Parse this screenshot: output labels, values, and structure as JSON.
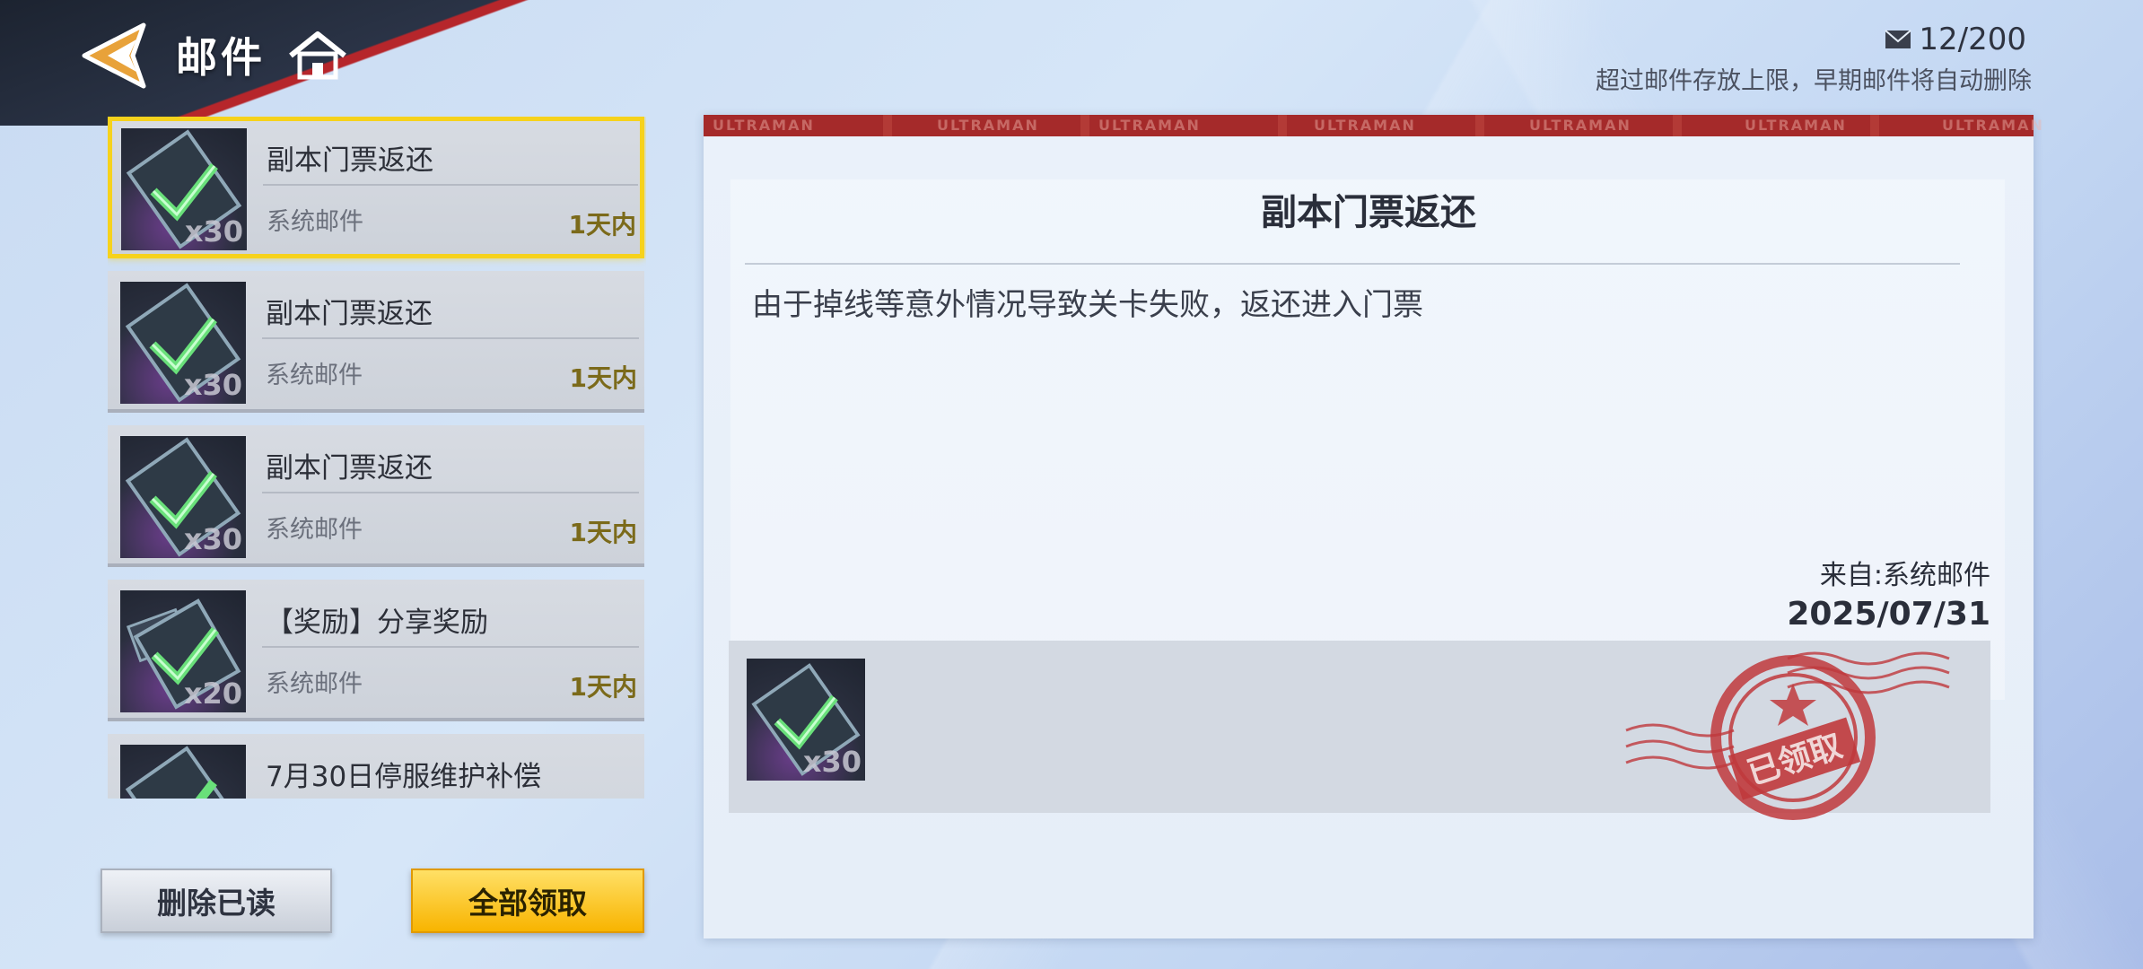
{
  "header": {
    "title": "邮件",
    "mail_count": "12/200",
    "mail_note": "超过邮件存放上限，早期邮件将自动删除"
  },
  "mail_list": [
    {
      "title": "副本门票返还",
      "sender": "系统邮件",
      "expire": "1天内",
      "qty": "x30",
      "selected": true
    },
    {
      "title": "副本门票返还",
      "sender": "系统邮件",
      "expire": "1天内",
      "qty": "x30"
    },
    {
      "title": "副本门票返还",
      "sender": "系统邮件",
      "expire": "1天内",
      "qty": "x30"
    },
    {
      "title": "【奖励】分享奖励",
      "sender": "系统邮件",
      "expire": "1天内",
      "qty": "x20"
    },
    {
      "title": "7月30日停服维护补偿",
      "sender": "",
      "expire": "",
      "qty": ""
    }
  ],
  "buttons": {
    "delete_read": "删除已读",
    "claim_all": "全部领取"
  },
  "detail": {
    "banner_text": "ULTRAMAN",
    "title": "副本门票返还",
    "body": "由于掉线等意外情况导致关卡失败，返还进入门票",
    "from": "来自:系统邮件",
    "date": "2025/07/31",
    "attachment_qty": "x30",
    "stamp_text": "已领取"
  },
  "colors": {
    "selected_border": "#f6d21c",
    "claim_button": "#f8b400",
    "banner_red": "#a52a2a",
    "stamp_red": "#c0383c"
  }
}
